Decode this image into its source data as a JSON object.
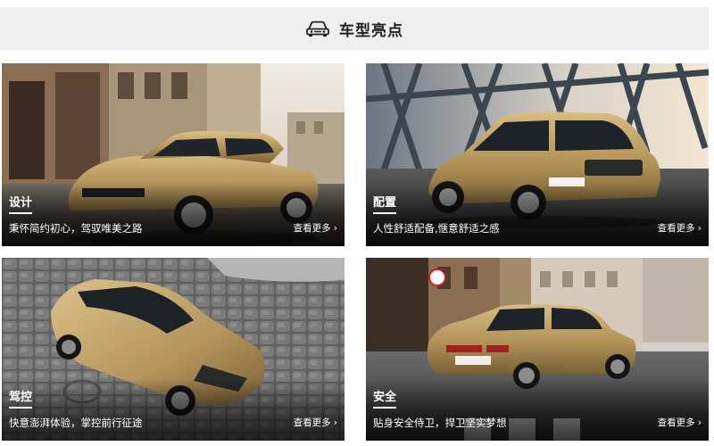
{
  "header": {
    "title": "车型亮点",
    "icon": "car-icon"
  },
  "cards": [
    {
      "id": "design",
      "label": "设计",
      "description": "秉怀简约初心，驾驭唯美之路",
      "more": "查看更多",
      "more_icon": "chevron-right-icon"
    },
    {
      "id": "config",
      "label": "配置",
      "description": "人性舒适配备,惬意舒适之感",
      "more": "查看更多",
      "more_icon": "chevron-right-icon"
    },
    {
      "id": "drive",
      "label": "驾控",
      "description": "快意澎湃体验，掌控前行征途",
      "more": "查看更多",
      "more_icon": "chevron-right-icon"
    },
    {
      "id": "safety",
      "label": "安全",
      "description": "贴身安全侍卫，捍卫坚实梦想",
      "more": "查看更多",
      "more_icon": "chevron-right-icon"
    }
  ],
  "colors": {
    "header_bg": "#efefef",
    "car_gold": "#b89a5c",
    "text_light": "#ffffff"
  }
}
